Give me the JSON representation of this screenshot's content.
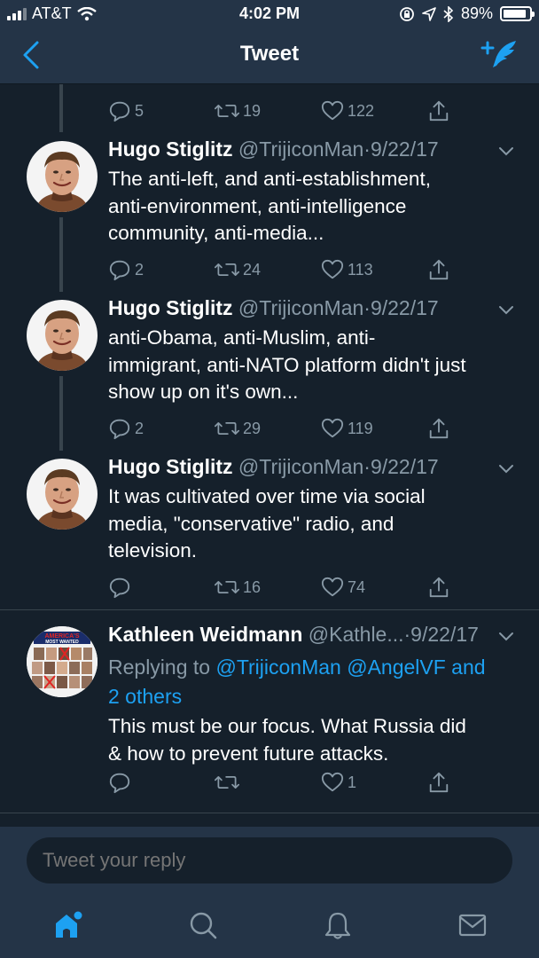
{
  "status_bar": {
    "carrier": "AT&T",
    "time": "4:02 PM",
    "battery": "89%",
    "battery_level": 0.89
  },
  "nav": {
    "title": "Tweet"
  },
  "tweets": [
    {
      "replies": "5",
      "retweets": "19",
      "likes": "122"
    },
    {
      "name": "Hugo Stiglitz",
      "handle": "@TrijiconMan",
      "date": "·9/22/17",
      "text": [
        "The anti-left, and anti-establishment,",
        "anti-environment, anti-intelligence",
        "community, anti-media..."
      ],
      "replies": "2",
      "retweets": "24",
      "likes": "113"
    },
    {
      "name": "Hugo Stiglitz",
      "handle": "@TrijiconMan",
      "date": "·9/22/17",
      "text": [
        "anti-Obama, anti-Muslim, anti-",
        "immigrant, anti-NATO platform didn't just",
        "show up on it's own..."
      ],
      "replies": "2",
      "retweets": "29",
      "likes": "119"
    },
    {
      "name": "Hugo Stiglitz",
      "handle": "@TrijiconMan",
      "date": "·9/22/17",
      "text": [
        "It was cultivated over time via social",
        "media, \"conservative\" radio, and",
        "television."
      ],
      "replies": "",
      "retweets": "16",
      "likes": "74"
    },
    {
      "name": "Kathleen Weidmann",
      "handle": "@Kathle...",
      "date": "·9/22/17",
      "replying_prefix": "Replying to ",
      "mention1": "@TrijiconMan",
      "mention2": "@AngelVF and",
      "mention3": "2 others",
      "text": [
        "This must be our focus. What Russia did",
        "& how to prevent future attacks."
      ],
      "avatar_text": [
        "AMERICA'S",
        "MOST WANTED"
      ],
      "replies": "",
      "retweets": "",
      "likes": "1"
    }
  ],
  "reply_bar": {
    "placeholder": "Tweet your reply"
  },
  "icons": {
    "back": "chevron-left-icon",
    "compose": "compose-tweet-icon",
    "reply": "reply-icon",
    "retweet": "retweet-icon",
    "like": "heart-icon",
    "share": "share-icon",
    "home": "home-icon",
    "search": "search-icon",
    "notifications": "bell-icon",
    "messages": "mail-icon"
  },
  "colors": {
    "background": "#15202b",
    "bar": "#243447",
    "accent": "#1da1f2",
    "muted": "#8899a6"
  }
}
